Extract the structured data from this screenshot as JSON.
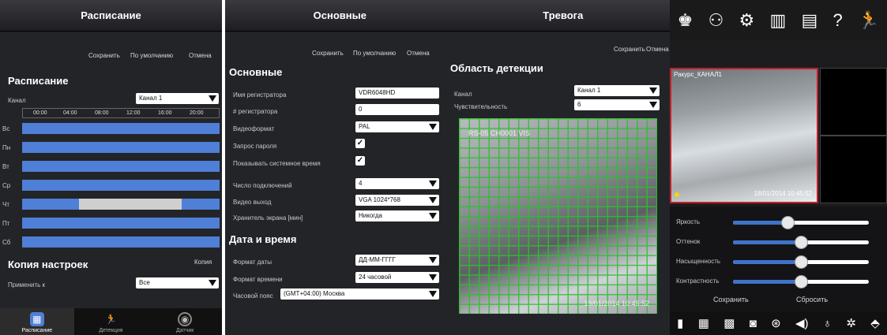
{
  "schedule": {
    "title": "Расписание",
    "save": "Сохранить",
    "default": "По умолчанию",
    "cancel": "Отмена",
    "section": "Расписание",
    "channel_label": "Канал",
    "channel_value": "Канал 1",
    "times": [
      "00:00",
      "04:00",
      "08:00",
      "12:00",
      "16:00",
      "20:00"
    ],
    "days": [
      "Вс",
      "Пн",
      "Вт",
      "Ср",
      "Чт",
      "Пт",
      "Сб"
    ],
    "copy_section": "Копия настроек",
    "copy_link": "Копия",
    "apply_label": "Применить к",
    "apply_value": "Все",
    "tabs": [
      {
        "label": "Расписание",
        "icon": "calendar-icon",
        "active": true
      },
      {
        "label": "Детекция",
        "icon": "running-man-icon"
      },
      {
        "label": "Датчик",
        "icon": "sensor-icon"
      }
    ]
  },
  "main": {
    "title": "Основные",
    "save": "Сохранить",
    "default": "По умолчанию",
    "cancel": "Отмена",
    "section": "Основные",
    "fields": [
      {
        "label": "Имя регистратора",
        "value": "VDR6048HD"
      },
      {
        "label": "# регистратора",
        "value": "0"
      },
      {
        "label": "Видеоформат",
        "value": "PAL"
      },
      {
        "label": "Запрос пароля",
        "value": "✓"
      },
      {
        "label": "Показывать системное время",
        "value": "✓"
      },
      {
        "label": "Число подключений",
        "value": "4"
      },
      {
        "label": "Видео выход",
        "value": "VGA 1024*768"
      },
      {
        "label": "Хранитель экрана [мин]",
        "value": "Никогда"
      }
    ],
    "dt_section": "Дата и время",
    "date_format_label": "Формат даты",
    "date_format_value": "ДД-ММ-ГГГГ",
    "time_format_label": "Формат времени",
    "time_format_value": "24 часовой",
    "tz_label": "Часовой пояс",
    "tz_value": "(GMT+04:00) Москва"
  },
  "alarm": {
    "title": "Тревога",
    "save": "Сохранить",
    "cancel": "Отмена",
    "section": "Область детекции",
    "channel_label": "Канал",
    "channel_value": "Канал 1",
    "sens_label": "Чувствительность",
    "sens_value": "6",
    "osd_time": "19/01/2014 10:45:52",
    "cam_name": "RS-05 CH0001 VIS"
  },
  "live": {
    "cam_label": "Ракурс_КАНАЛ1",
    "timestamp": "18/01/2014 10:45:52",
    "adjust": [
      {
        "label": "Яркость",
        "level": 0.4
      },
      {
        "label": "Оттенок",
        "level": 0.5
      },
      {
        "label": "Насыщенность",
        "level": 0.5
      },
      {
        "label": "Контрастность",
        "level": 0.5
      }
    ],
    "save": "Сохранить",
    "reset": "Сбросить",
    "top_icons": [
      "user-icon",
      "group-icon",
      "settings-gear-icon",
      "signal-bars-icon",
      "report-icon",
      "help-icon",
      "running-man-icon"
    ],
    "bottom_icons": [
      "layout-1-icon",
      "layout-4-icon",
      "layout-9-icon",
      "snapshot-icon",
      "ptz-icon",
      "speaker-icon",
      "microphone-icon",
      "settings-icon",
      "more-icon"
    ]
  }
}
